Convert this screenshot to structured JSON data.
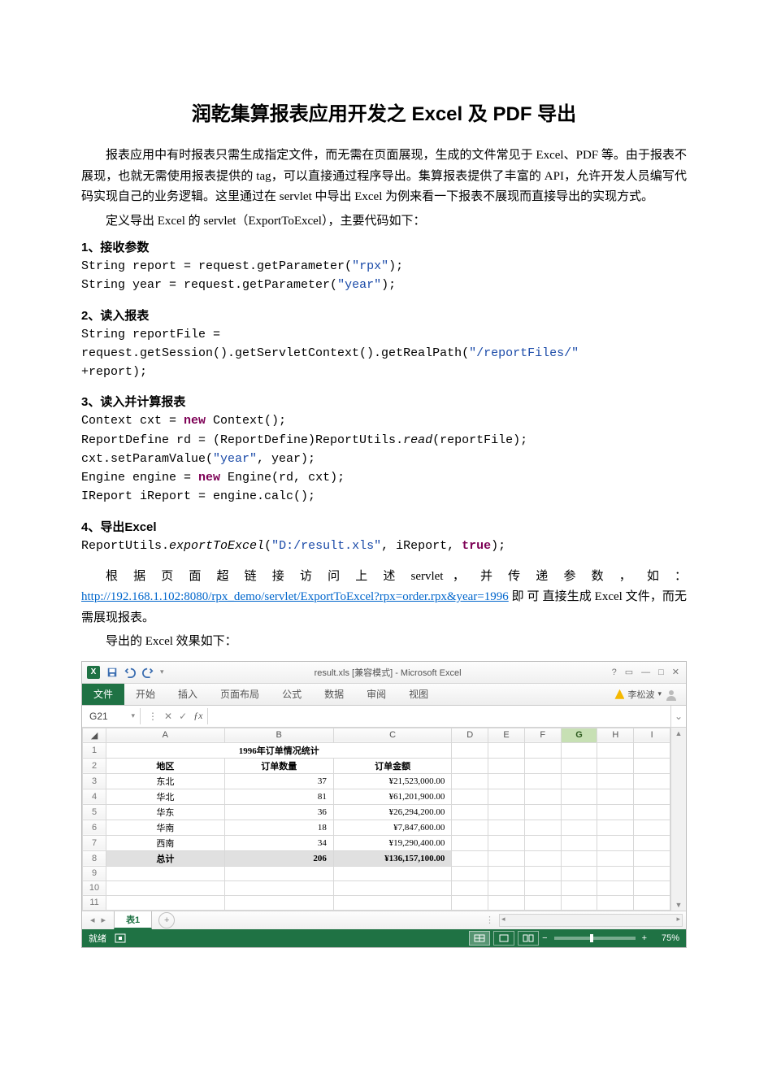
{
  "title": "润乾集算报表应用开发之 Excel 及 PDF 导出",
  "paragraphs": {
    "p1": "报表应用中有时报表只需生成指定文件，而无需在页面展现，生成的文件常见于 Excel、PDF 等。由于报表不展现，也就无需使用报表提供的 tag，可以直接通过程序导出。集算报表提供了丰富的 API，允许开发人员编写代码实现自己的业务逻辑。这里通过在 servlet 中导出 Excel 为例来看一下报表不展现而直接导出的实现方式。",
    "p2": "定义导出 Excel 的 servlet（ExportToExcel），主要代码如下：",
    "p3a": "根 据 页 面 超 链 接 访 问 上 述  servlet ， 并 传 递 参 数 ， 如 ：",
    "url": "http://192.168.1.102:8080/rpx_demo/servlet/ExportToExcel?rpx=order.rpx&year=1996",
    "p3b": " 即 可 直接生成 Excel 文件，而无需展现报表。",
    "p4": "导出的 Excel 效果如下："
  },
  "sections": {
    "s1": "1、接收参数",
    "s2": "2、读入报表",
    "s3": "3、读入并计算报表",
    "s4": "4、导出Excel"
  },
  "code": {
    "c1a": "String report = request.getParameter(",
    "c1a_s": "\"rpx\"",
    "c1a_e": ");",
    "c1b": "String year = request.getParameter(",
    "c1b_s": "\"year\"",
    "c1b_e": ");",
    "c2a": "String reportFile =",
    "c2b": "request.getSession().getServletContext().getRealPath(",
    "c2b_s": "\"/reportFiles/\"",
    "c2c": "+report);",
    "c3a": "Context cxt = ",
    "c3a_kw": "new",
    "c3a_e": " Context();",
    "c3b": "ReportDefine rd = (ReportDefine)ReportUtils.",
    "c3b_it": "read",
    "c3b_e": "(reportFile);",
    "c3c": "cxt.setParamValue(",
    "c3c_s1": "\"year\"",
    "c3c_m": ", year);",
    "c3d": "Engine engine = ",
    "c3d_kw": "new",
    "c3d_e": " Engine(rd, cxt);",
    "c3e": "IReport iReport = engine.calc();",
    "c4a": "ReportUtils.",
    "c4a_it": "exportToExcel",
    "c4a_m": "(",
    "c4a_s": "\"D:/result.xls\"",
    "c4a_m2": ", iReport, ",
    "c4a_kw": "true",
    "c4a_e": ");"
  },
  "excel": {
    "win_title": "result.xls [兼容模式] - Microsoft Excel",
    "user": "李松波",
    "ribbon": [
      "文件",
      "开始",
      "插入",
      "页面布局",
      "公式",
      "数据",
      "审阅",
      "视图"
    ],
    "namebox": "G21",
    "cols": [
      "A",
      "B",
      "C",
      "D",
      "E",
      "F",
      "G",
      "H",
      "I"
    ],
    "merged_title": "1996年订单情况统计",
    "headers": [
      "地区",
      "订单数量",
      "订单金额"
    ],
    "rows": [
      [
        "东北",
        "37",
        "¥21,523,000.00"
      ],
      [
        "华北",
        "81",
        "¥61,201,900.00"
      ],
      [
        "华东",
        "36",
        "¥26,294,200.00"
      ],
      [
        "华南",
        "18",
        "¥7,847,600.00"
      ],
      [
        "西南",
        "34",
        "¥19,290,400.00"
      ]
    ],
    "total": [
      "总计",
      "206",
      "¥136,157,100.00"
    ],
    "sheet": "表1",
    "status": "就绪",
    "zoom": "75%"
  }
}
